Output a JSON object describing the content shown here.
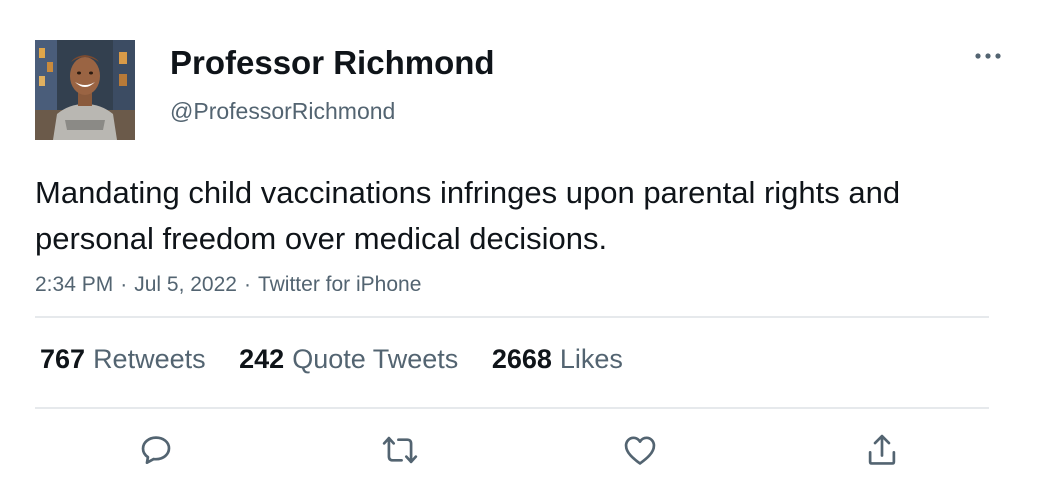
{
  "user": {
    "display_name": "Professor Richmond",
    "handle": "@ProfessorRichmond",
    "avatar_icon": "profile-photo"
  },
  "tweet": {
    "text": "Mandating child vaccinations infringes upon parental rights and personal freedom over medical decisions.",
    "time": "2:34 PM",
    "date": "Jul 5, 2022",
    "source": "Twitter for iPhone",
    "separator": "·"
  },
  "stats": {
    "retweets": {
      "count": "767",
      "label": "Retweets"
    },
    "quotes": {
      "count": "242",
      "label": "Quote Tweets"
    },
    "likes": {
      "count": "2668",
      "label": "Likes"
    }
  },
  "actions": [
    {
      "icon": "reply-icon"
    },
    {
      "icon": "retweet-icon"
    },
    {
      "icon": "like-icon"
    },
    {
      "icon": "share-icon"
    }
  ],
  "colors": {
    "text": "#0f1419",
    "secondary": "#536471",
    "divider": "#e6e9ec",
    "icon": "#536471"
  }
}
